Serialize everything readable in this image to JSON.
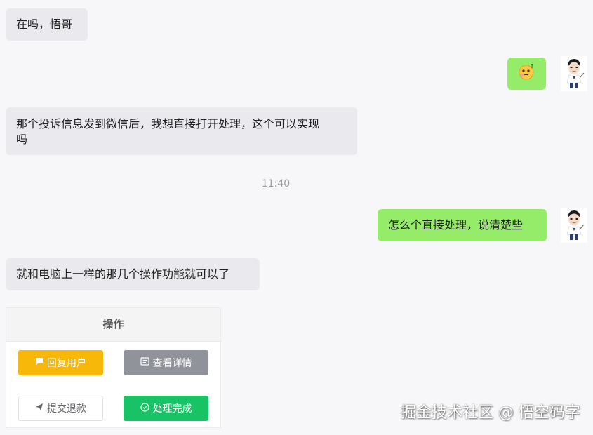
{
  "conversation": {
    "messages": [
      {
        "side": "left",
        "text": "在吗，悟哥"
      },
      {
        "side": "right",
        "emoji": "thinking-face"
      },
      {
        "side": "left",
        "line1": "那个投诉信息发到微信后，我想直接打开处理，这个可以实现",
        "line2": "吗"
      },
      {
        "side": "right",
        "text": "怎么个直接处理，说清楚些"
      },
      {
        "side": "left",
        "text": "就和电脑上一样的那几个操作功能就可以了"
      }
    ],
    "timestamp": "11:40"
  },
  "operation_panel": {
    "header": "操作",
    "buttons": {
      "reply": "回复用户",
      "detail": "查看详情",
      "refund": "提交退款",
      "done": "处理完成"
    },
    "colors": {
      "reply": "#f8b80a",
      "detail": "#909399",
      "done": "#19c265"
    }
  },
  "icons": {
    "reply": "comment-icon",
    "detail": "document-icon",
    "refund": "send-icon",
    "done": "check-circle-icon"
  },
  "watermark": "掘金技术社区 @ 悟空码字",
  "colors": {
    "background": "#f7f7f9",
    "bubble_left": "#eaeaee",
    "bubble_right": "#95ec69"
  }
}
